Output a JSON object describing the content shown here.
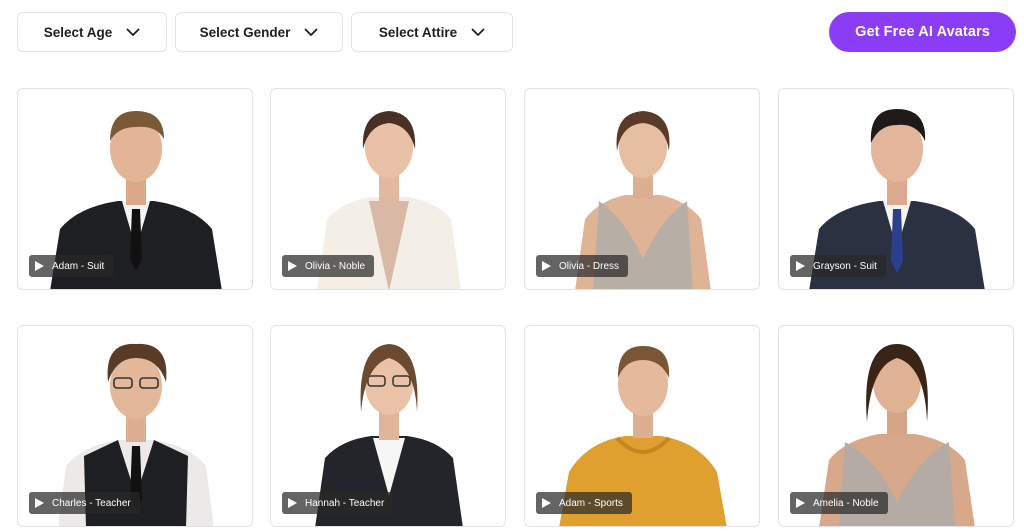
{
  "filters": {
    "age_label": "Select Age",
    "gender_label": "Select Gender",
    "attire_label": "Select Attire"
  },
  "cta": {
    "label": "Get Free AI Avatars",
    "color": "#8b3df5"
  },
  "avatars": [
    {
      "label": "Adam - Suit"
    },
    {
      "label": "Olivia - Noble"
    },
    {
      "label": "Olivia - Dress"
    },
    {
      "label": "Grayson - Suit"
    },
    {
      "label": "Charles - Teacher"
    },
    {
      "label": "Hannah - Teacher"
    },
    {
      "label": "Adam - Sports"
    },
    {
      "label": "Amelia - Noble"
    }
  ]
}
